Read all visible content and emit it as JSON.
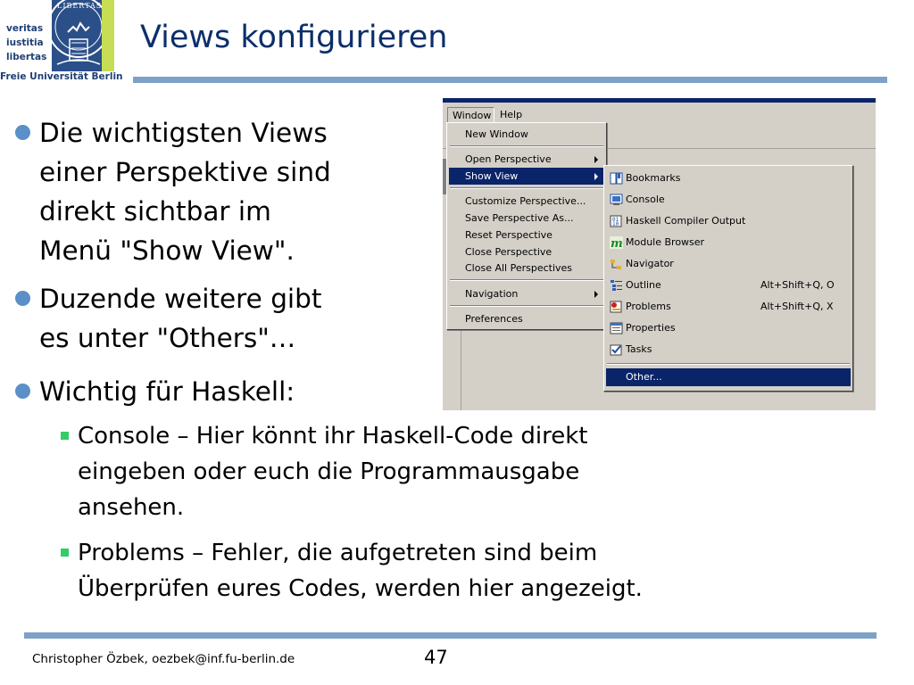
{
  "logo": {
    "motto": [
      "veritas",
      "iustitia",
      "libertas"
    ],
    "seal_text": "LIBERTAS",
    "university": "Freie Universität Berlin"
  },
  "slide": {
    "title": "Views konfigurieren",
    "bullets": [
      {
        "lines": [
          "Die wichtigsten Views",
          "einer Perspektive sind",
          "direkt sichtbar im",
          "Menü \"Show View\"."
        ]
      },
      {
        "lines": [
          "Duzende weitere gibt",
          "es unter \"Others\"…"
        ]
      },
      {
        "lines": [
          "Wichtig für Haskell:"
        ]
      }
    ],
    "subbullets": [
      {
        "lines": [
          "Console – Hier könnt ihr Haskell-Code direkt",
          "eingeben oder euch die Programmausgabe",
          "ansehen."
        ]
      },
      {
        "lines": [
          "Problems – Fehler, die aufgetreten sind beim",
          "Überprüfen eures Codes, werden hier angezeigt."
        ]
      }
    ]
  },
  "screenshot": {
    "menubar": {
      "window": "Window",
      "help": "Help"
    },
    "window_menu": [
      "New Window",
      "Open Perspective",
      "Show View",
      "Customize Perspective...",
      "Save Perspective As...",
      "Reset Perspective",
      "Close Perspective",
      "Close All Perspectives",
      "Navigation",
      "Preferences"
    ],
    "show_view_menu": [
      {
        "label": "Bookmarks",
        "shortcut": "",
        "icon": "bookmarks-icon"
      },
      {
        "label": "Console",
        "shortcut": "",
        "icon": "console-icon"
      },
      {
        "label": "Haskell Compiler Output",
        "shortcut": "",
        "icon": "compiler-output-icon"
      },
      {
        "label": "Module Browser",
        "shortcut": "",
        "icon": "module-browser-icon"
      },
      {
        "label": "Navigator",
        "shortcut": "",
        "icon": "navigator-icon"
      },
      {
        "label": "Outline",
        "shortcut": "Alt+Shift+Q, O",
        "icon": "outline-icon"
      },
      {
        "label": "Problems",
        "shortcut": "Alt+Shift+Q, X",
        "icon": "problems-icon"
      },
      {
        "label": "Properties",
        "shortcut": "",
        "icon": "properties-icon"
      },
      {
        "label": "Tasks",
        "shortcut": "",
        "icon": "tasks-icon"
      },
      {
        "label": "Other...",
        "shortcut": "",
        "icon": ""
      }
    ],
    "colors": {
      "menu_bg": "#d4d0c8",
      "selection": "#0a246a"
    }
  },
  "footer": {
    "author": "Christopher Özbek, oezbek@inf.fu-berlin.de",
    "page": "47"
  }
}
